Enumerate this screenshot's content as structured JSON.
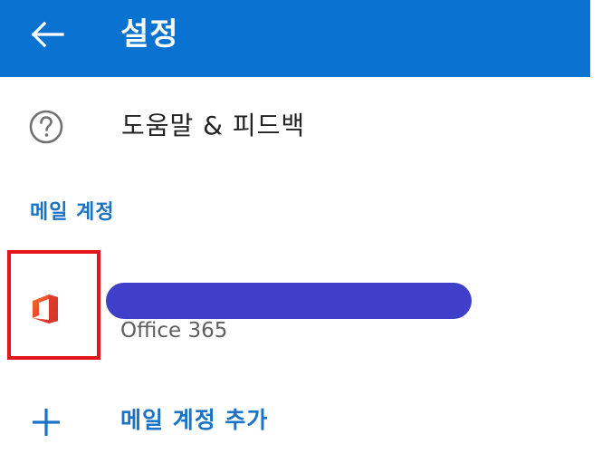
{
  "header": {
    "title": "설정",
    "background_color": "#0a73d1",
    "back_icon": "arrow-left-icon"
  },
  "help": {
    "label": "도움말 & 피드백",
    "icon": "question-circle-icon"
  },
  "mail_accounts": {
    "section_title": "메일 계정",
    "accounts": [
      {
        "type": "Office 365",
        "icon": "office-logo-icon",
        "name_redacted": true
      }
    ]
  },
  "add_account": {
    "label": "메일 계정 추가",
    "icon": "plus-icon"
  },
  "colors": {
    "accent": "#1a73c4",
    "highlight": "#e1151b",
    "redaction": "#3f3fc9"
  }
}
